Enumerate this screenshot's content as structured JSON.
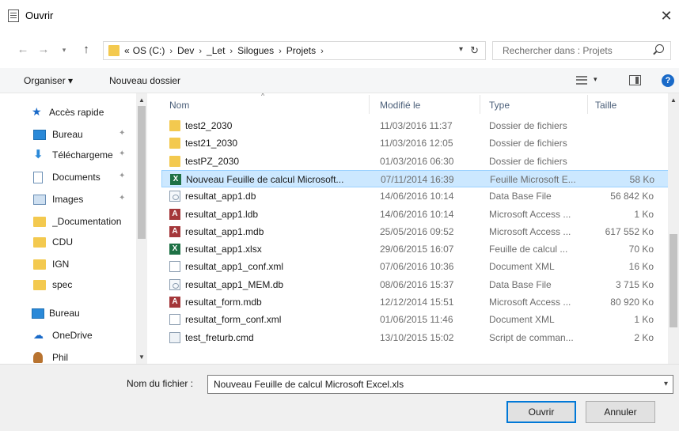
{
  "window": {
    "title": "Ouvrir"
  },
  "address": {
    "crumbs": [
      "«",
      "OS (C:)",
      "Dev",
      "_Let",
      "Silogues",
      "Projets"
    ],
    "search_placeholder": "Rechercher dans : Projets"
  },
  "toolbar": {
    "organise_label": "Organiser ▾",
    "newfolder_label": "Nouveau dossier"
  },
  "nav": {
    "items": [
      {
        "label": "Accès rapide",
        "icon": "star-icon",
        "indent": 0
      },
      {
        "label": "Bureau",
        "icon": "desktop-icon",
        "indent": 1,
        "pinned": true
      },
      {
        "label": "Téléchargemе",
        "icon": "download-icon",
        "indent": 1,
        "pinned": true
      },
      {
        "label": "Documents",
        "icon": "document-icon",
        "indent": 1,
        "pinned": true
      },
      {
        "label": "Images",
        "icon": "image-icon",
        "indent": 1,
        "pinned": true
      },
      {
        "label": "_Documentation",
        "icon": "folder-icon",
        "indent": 1
      },
      {
        "label": "CDU",
        "icon": "folder-icon",
        "indent": 1
      },
      {
        "label": "IGN",
        "icon": "folder-icon",
        "indent": 1
      },
      {
        "label": "spec",
        "icon": "folder-icon",
        "indent": 1
      },
      {
        "label": "Bureau",
        "icon": "desktop-icon",
        "indent": 0
      },
      {
        "label": "OneDrive",
        "icon": "cloud-icon",
        "indent": 1
      },
      {
        "label": "Phil",
        "icon": "user-icon",
        "indent": 1
      }
    ]
  },
  "columns": {
    "name": "Nom",
    "date": "Modifié le",
    "type": "Type",
    "size": "Taille"
  },
  "files": [
    {
      "name": "test2_2030",
      "date": "11/03/2016 11:37",
      "type": "Dossier de fichiers",
      "size": "",
      "icon": "folder"
    },
    {
      "name": "test21_2030",
      "date": "11/03/2016 12:05",
      "type": "Dossier de fichiers",
      "size": "",
      "icon": "folder"
    },
    {
      "name": "testPZ_2030",
      "date": "01/03/2016 06:30",
      "type": "Dossier de fichiers",
      "size": "",
      "icon": "folder"
    },
    {
      "name": "Nouveau Feuille de calcul Microsoft...",
      "date": "07/11/2014 16:39",
      "type": "Feuille Microsoft E...",
      "size": "58 Ko",
      "icon": "xls",
      "selected": true
    },
    {
      "name": "resultat_app1.db",
      "date": "14/06/2016 10:14",
      "type": "Data Base File",
      "size": "56 842 Ko",
      "icon": "db"
    },
    {
      "name": "resultat_app1.ldb",
      "date": "14/06/2016 10:14",
      "type": "Microsoft Access ...",
      "size": "1 Ko",
      "icon": "access"
    },
    {
      "name": "resultat_app1.mdb",
      "date": "25/05/2016 09:52",
      "type": "Microsoft Access ...",
      "size": "617 552 Ko",
      "icon": "access"
    },
    {
      "name": "resultat_app1.xlsx",
      "date": "29/06/2015 16:07",
      "type": "Feuille de calcul ...",
      "size": "70 Ko",
      "icon": "xls"
    },
    {
      "name": "resultat_app1_conf.xml",
      "date": "07/06/2016 10:36",
      "type": "Document XML",
      "size": "16 Ko",
      "icon": "xml"
    },
    {
      "name": "resultat_app1_MEM.db",
      "date": "08/06/2016 15:37",
      "type": "Data Base File",
      "size": "3 715 Ko",
      "icon": "db"
    },
    {
      "name": "resultat_form.mdb",
      "date": "12/12/2014 15:51",
      "type": "Microsoft Access ...",
      "size": "80 920 Ko",
      "icon": "access"
    },
    {
      "name": "resultat_form_conf.xml",
      "date": "01/06/2015 11:46",
      "type": "Document XML",
      "size": "1 Ko",
      "icon": "xml"
    },
    {
      "name": "test_freturb.cmd",
      "date": "13/10/2015 15:02",
      "type": "Script de comman...",
      "size": "2 Ko",
      "icon": "cmd"
    }
  ],
  "footer": {
    "filename_label": "Nom du fichier :",
    "filename_value": "Nouveau Feuille de calcul Microsoft Excel.xls",
    "open_label": "Ouvrir",
    "cancel_label": "Annuler"
  }
}
